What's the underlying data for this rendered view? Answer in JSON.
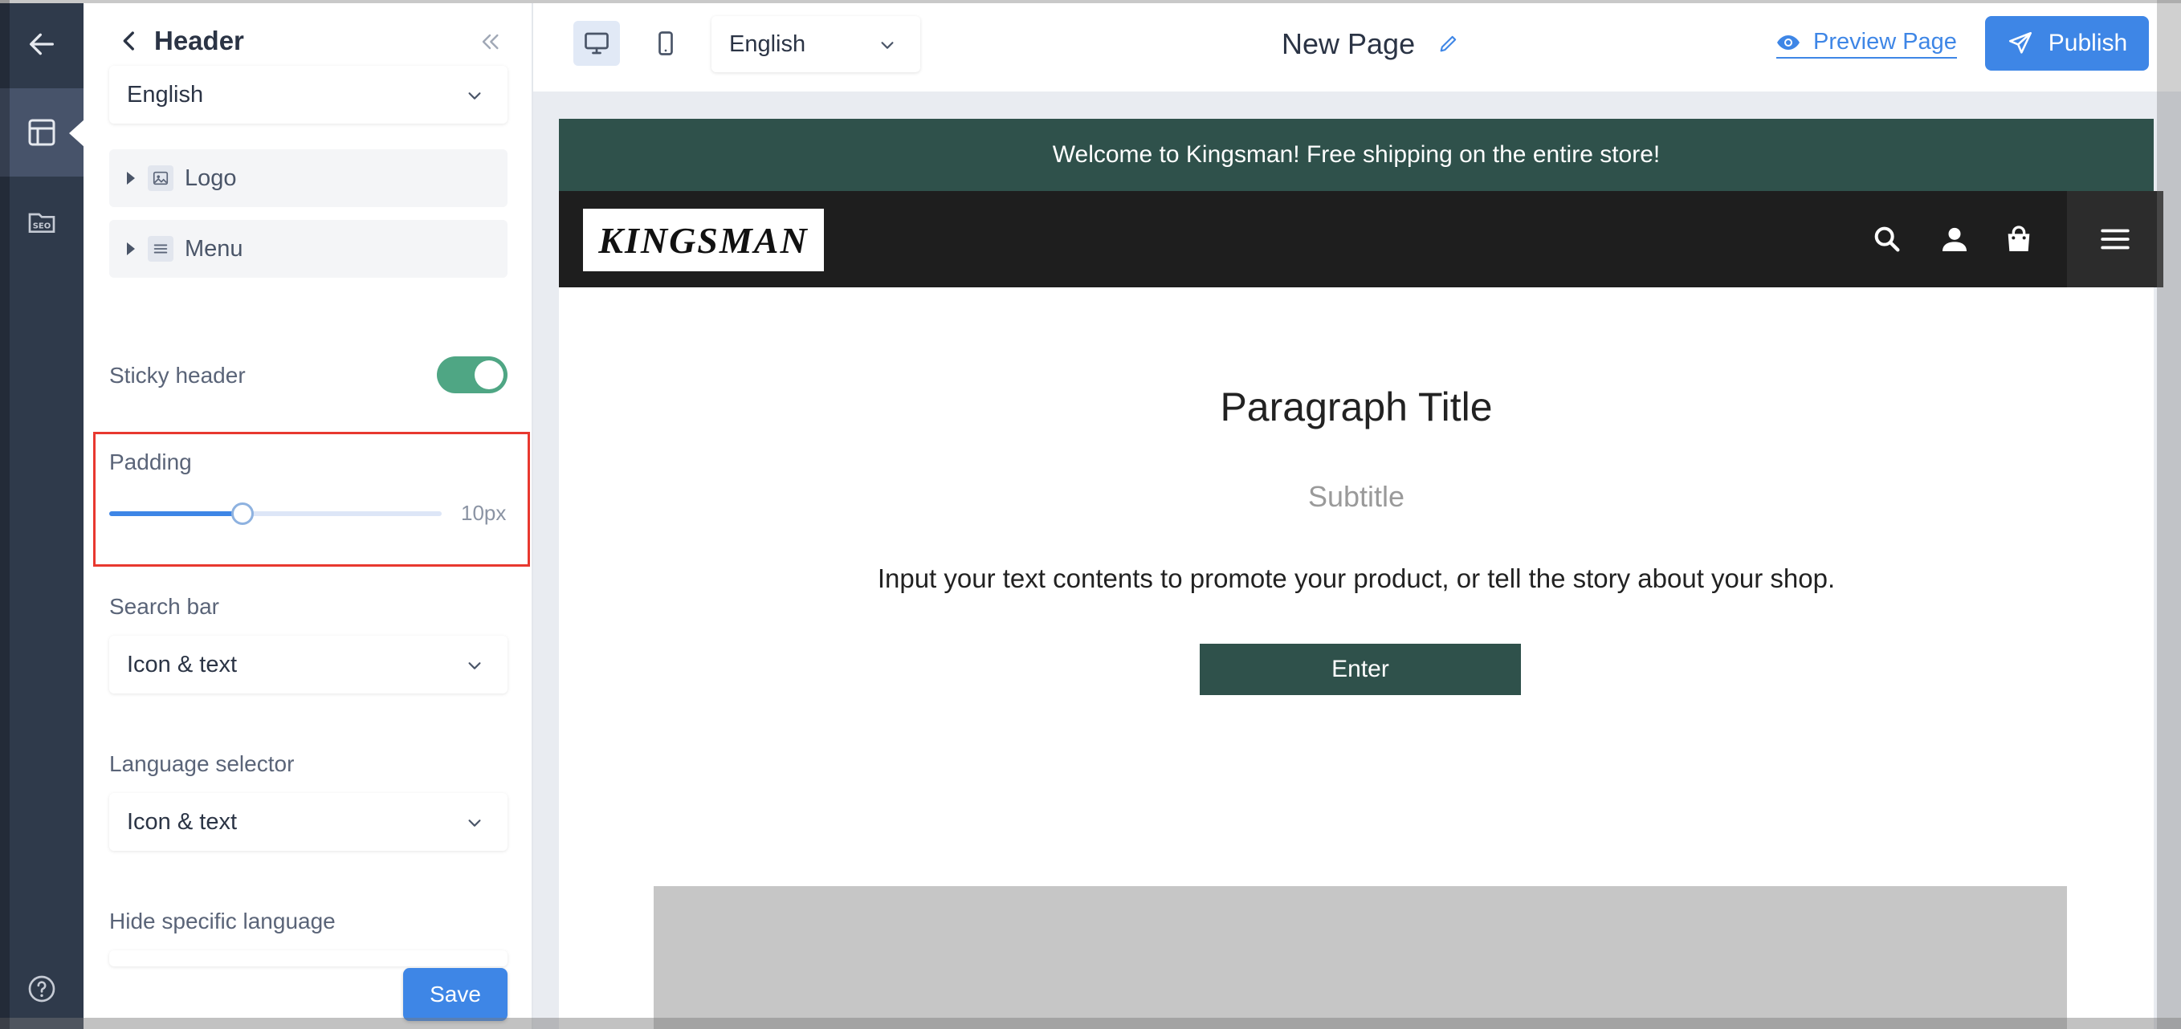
{
  "panel": {
    "title": "Header",
    "language_value": "English",
    "tree": [
      {
        "label": "Logo"
      },
      {
        "label": "Menu"
      }
    ],
    "sticky_header": {
      "label": "Sticky header",
      "enabled": true
    },
    "padding": {
      "label": "Padding",
      "value_text": "10px",
      "fraction": 0.4
    },
    "search_bar": {
      "label": "Search bar",
      "value": "Icon & text"
    },
    "language_selector": {
      "label": "Language selector",
      "value": "Icon & text"
    },
    "hide_language": {
      "label": "Hide specific language"
    },
    "save_label": "Save"
  },
  "toolbar": {
    "language": "English",
    "page_title": "New Page",
    "preview_label": "Preview Page",
    "publish_label": "Publish"
  },
  "preview": {
    "announcement": "Welcome to Kingsman! Free shipping on the entire store!",
    "logo_text": "KINGSMAN",
    "title": "Paragraph Title",
    "subtitle": "Subtitle",
    "body": "Input your text contents to promote your product, or tell the story about your shop.",
    "button_label": "Enter"
  },
  "colors": {
    "accent": "#3e86e6",
    "brand_green": "#2f514b",
    "toggle_on": "#4fa684",
    "highlight": "#e8382f"
  },
  "icons": [
    "back-arrow-icon",
    "layout-icon",
    "seo-icon",
    "help-icon",
    "chevron-left-icon",
    "collapse-icon",
    "image-icon",
    "menu-lines-icon",
    "desktop-icon",
    "mobile-icon",
    "pencil-icon",
    "eye-icon",
    "send-icon",
    "search-icon",
    "user-icon",
    "shopping-bag-icon",
    "hamburger-icon"
  ]
}
